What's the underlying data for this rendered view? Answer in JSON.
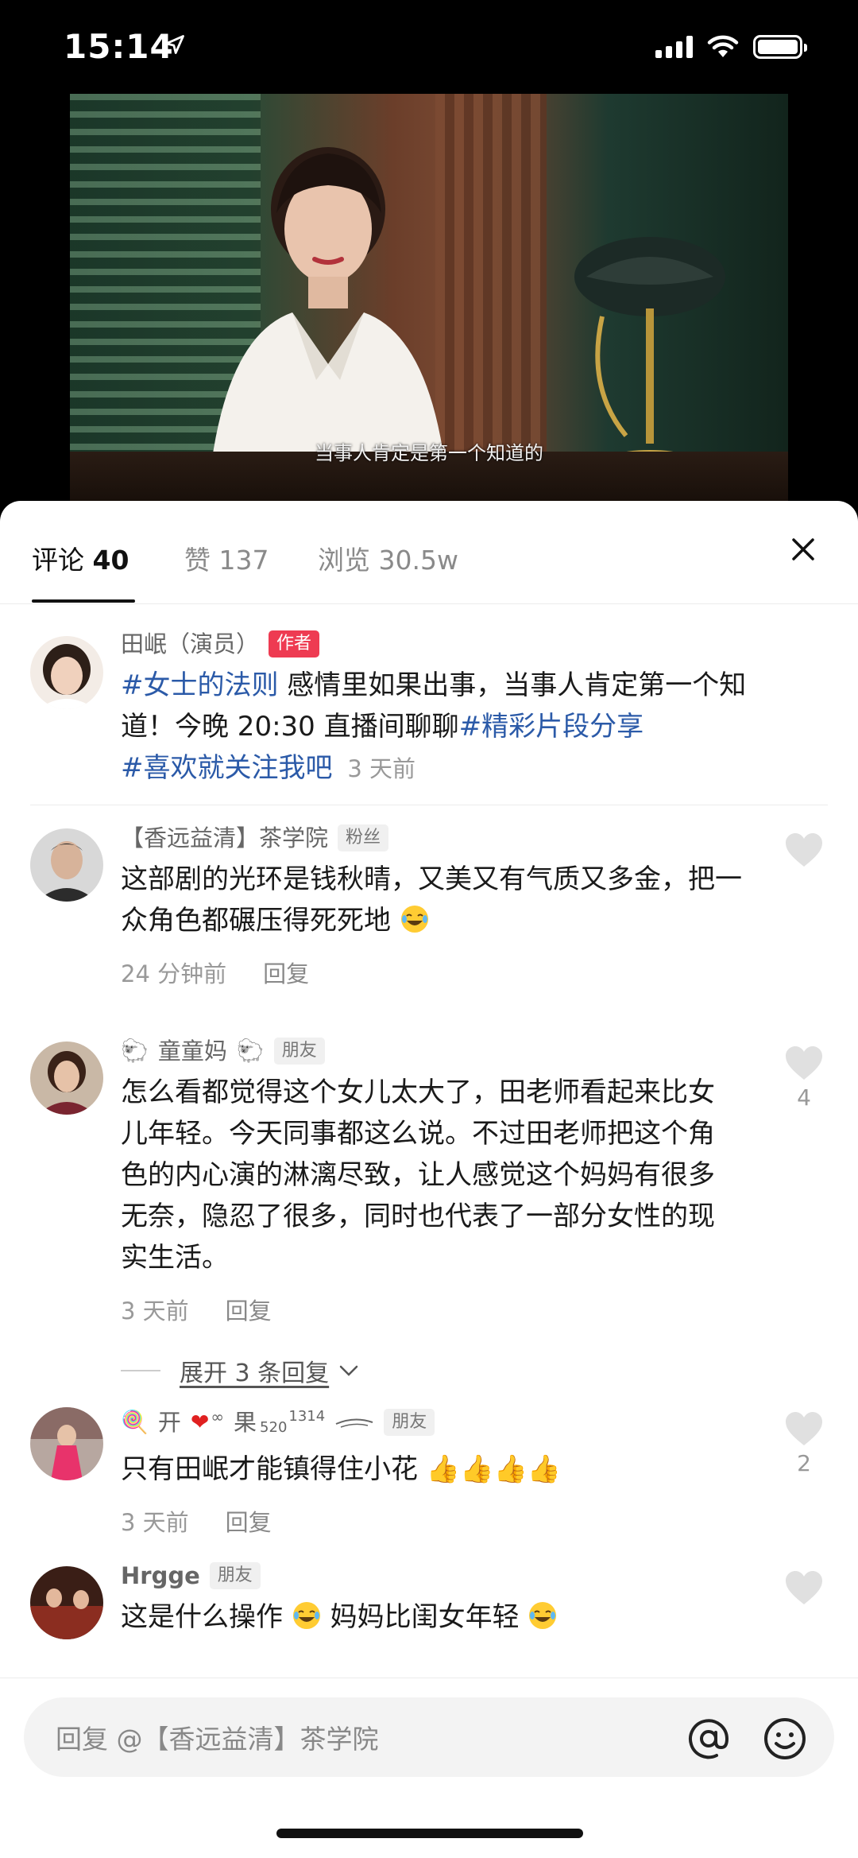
{
  "status_bar": {
    "time": "15:14"
  },
  "video": {
    "subtitle": "当事人肯定是第一个知道的"
  },
  "tabs": [
    {
      "label": "评论",
      "count": "40"
    },
    {
      "label": "赞",
      "count": "137"
    },
    {
      "label": "浏览",
      "count": "30.5w"
    }
  ],
  "post": {
    "author": "田岷（演员）",
    "badge": "作者",
    "hashtag1": "#女士的法则",
    "text1": " 感情里如果出事，当事人肯定第一个知道！今晚 20:30 直播间聊聊",
    "hashtag2": "#精彩片段分享",
    "hashtag3": "#喜欢就关注我吧",
    "time": "3 天前"
  },
  "comments": [
    {
      "name": "【香远益清】茶学院",
      "badge": "粉丝",
      "text": "这部剧的光环是钱秋晴，又美又有气质又多金，把一众角色都碾压得死死地",
      "time": "24 分钟前",
      "reply": "回复",
      "likes": ""
    },
    {
      "name": "童童妈",
      "badge": "朋友",
      "text": "怎么看都觉得这个女儿太大了，田老师看起来比女儿年轻。今天同事都这么说。不过田老师把这个角色的内心演的淋漓尽致，让人感觉这个妈妈有很多无奈，隐忍了很多，同时也代表了一部分女性的现实生活。",
      "time": "3 天前",
      "reply": "回复",
      "likes": "4",
      "expand": "展开 3 条回复"
    },
    {
      "name": "开",
      "name_suffix": "果",
      "name_sub": "520",
      "name_sup": "1314",
      "badge": "朋友",
      "text": "只有田岷才能镇得住小花",
      "time": "3 天前",
      "reply": "回复",
      "likes": "2"
    },
    {
      "name": "Hrgge",
      "badge": "朋友",
      "text_part1": "这是什么操作",
      "text_part2": " 妈妈比闺女年轻",
      "likes": ""
    }
  ],
  "reply_bar": {
    "placeholder": "回复 @【香远益清】茶学院"
  },
  "colors": {
    "hashtag": "#2b5aa8",
    "author_badge": "#ee3b52"
  },
  "icons": [
    "location-arrow-icon",
    "signal-icon",
    "wifi-icon",
    "battery-icon",
    "close-icon",
    "heart-icon",
    "chevron-down-icon",
    "at-icon",
    "emoji-icon"
  ]
}
